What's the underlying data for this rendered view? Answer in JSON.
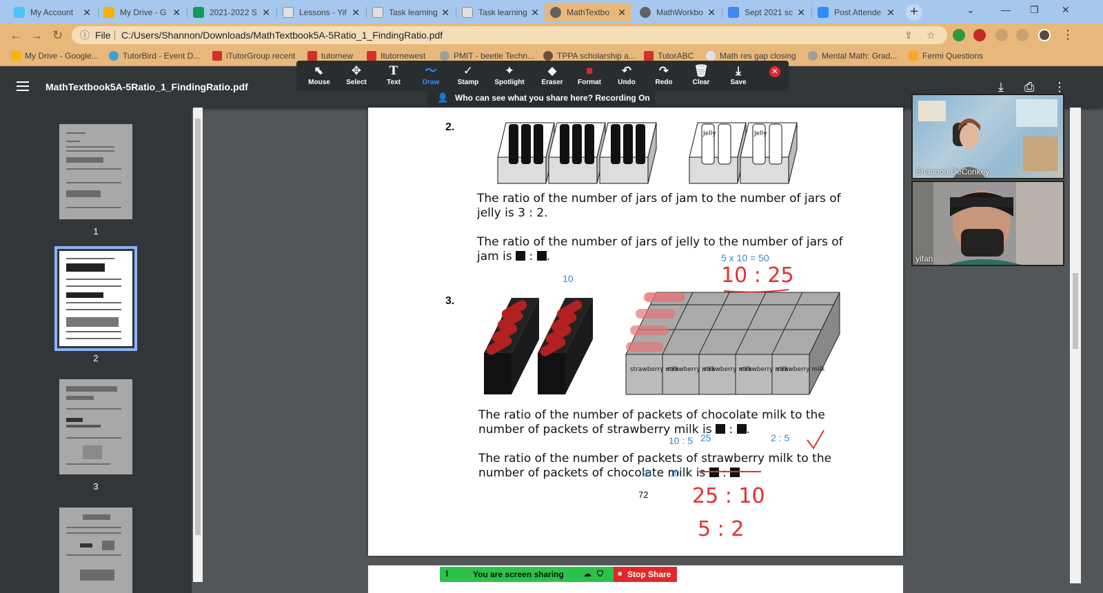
{
  "tabs": [
    {
      "label": "My Account",
      "color": "#4fc3f7"
    },
    {
      "label": "My Drive - G",
      "color": "#f4b400"
    },
    {
      "label": "2021-2022 S",
      "color": "#0f9d58"
    },
    {
      "label": "Lessons - Yif",
      "color": "#9e9e9e"
    },
    {
      "label": "Task learning",
      "color": "#9e9e9e"
    },
    {
      "label": "Task learning",
      "color": "#9e9e9e"
    },
    {
      "label": "MathTextbo",
      "color": "#616161"
    },
    {
      "label": "MathWorkbo",
      "color": "#616161"
    },
    {
      "label": "Sept 2021 sc",
      "color": "#4285f4"
    },
    {
      "label": "Post Attende",
      "color": "#2d8cff"
    }
  ],
  "address": {
    "scheme": "File",
    "url": "C:/Users/Shannon/Downloads/MathTextbook5A-5Ratio_1_FindingRatio.pdf"
  },
  "bookmarks": [
    "My Drive - Google...",
    "TutorBird - Event D...",
    "iTutorGroup recent",
    "tutornew",
    "Itutornewest",
    "PMIT - beetle Techn...",
    "TPPA scholarship a...",
    "TutorABC",
    "Math res gap closing",
    "Mental Math: Grad...",
    "Fermi Questions"
  ],
  "pdf": {
    "title": "MathTextbook5A-5Ratio_1_FindingRatio.pdf",
    "thumbnails": [
      "1",
      "2",
      "3"
    ]
  },
  "zoom_tools": [
    {
      "label": "Mouse",
      "icon": "⬉"
    },
    {
      "label": "Select",
      "icon": "✥"
    },
    {
      "label": "Text",
      "icon": "T"
    },
    {
      "label": "Draw",
      "icon": "〜"
    },
    {
      "label": "Stamp",
      "icon": "✓"
    },
    {
      "label": "Spotlight",
      "icon": "✦"
    },
    {
      "label": "Eraser",
      "icon": "◆"
    },
    {
      "label": "Format",
      "icon": "■"
    },
    {
      "label": "Undo",
      "icon": "↶"
    },
    {
      "label": "Redo",
      "icon": "↷"
    },
    {
      "label": "Clear",
      "icon": "🗑"
    },
    {
      "label": "Save",
      "icon": "⤓"
    }
  ],
  "zoom_notice": "Who can see what you share here? Recording On",
  "page": {
    "q2_number": "2.",
    "q2_line1": "The ratio of the number of jars of jam to the number of jars of jelly is 3 : 2.",
    "q2_line2": "The ratio of the number of jars of jelly to the number of jars of jam is",
    "q3_number": "3.",
    "q3_line1": "The ratio of the number of packets of chocolate milk to the number of packets of strawberry milk is",
    "q3_line2": "The ratio of the number of packets of strawberry milk to the number of packets of chocolate milk is",
    "page_number": "72",
    "jelly_label": "Jelly",
    "carton_label": "strawberry milk"
  },
  "annotations": {
    "typed_10": "10",
    "typed_calc": "5 x 10 = 50",
    "typed_ratio_a": "10 : 5",
    "typed_25": "25",
    "typed_ratio_b": "2 : 5",
    "typed_q3b_25": "25",
    "typed_q3b_10": "10",
    "hand_ratio1": "10 : 25",
    "hand_ratio2": "25 : 10",
    "hand_ratio3": "5 : 2"
  },
  "participants": [
    {
      "name": "Shannon DeConkey"
    },
    {
      "name": "yifan"
    }
  ],
  "share": {
    "status": "You are screen sharing",
    "stop": "Stop Share"
  }
}
